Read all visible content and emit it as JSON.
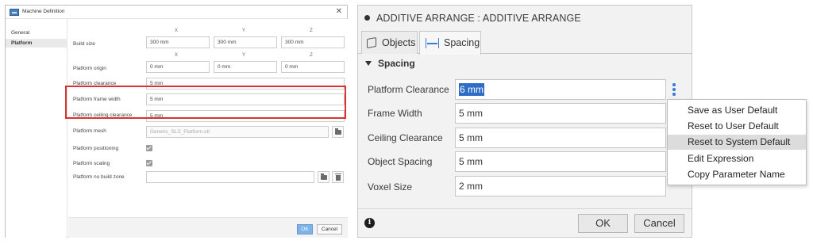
{
  "machine_definition": {
    "title": "Machine Definition",
    "close_glyph": "✕",
    "nav": [
      "General",
      "Platform"
    ],
    "axes": [
      "X",
      "Y",
      "Z"
    ],
    "build_size": {
      "label": "Build size",
      "x": "300 mm",
      "y": "300 mm",
      "z": "300 mm"
    },
    "platform_origin": {
      "label": "Platform origin",
      "x": "0 mm",
      "y": "0 mm",
      "z": "0 mm"
    },
    "platform_clearance": {
      "label": "Platform clearance",
      "value": "5 mm"
    },
    "platform_frame_width": {
      "label": "Platform frame width",
      "value": "5 mm"
    },
    "platform_ceiling_clearance": {
      "label": "Platform ceiling clearance",
      "value": "5 mm"
    },
    "platform_mesh": {
      "label": "Platform mesh",
      "value": "Generic_SLS_Platform.stl"
    },
    "platform_positioning": {
      "label": "Platform positioning",
      "checked": true
    },
    "platform_scaling": {
      "label": "Platform scaling",
      "checked": true
    },
    "platform_no_build_zone": {
      "label": "Platform no build zone",
      "value": ""
    },
    "ok_label": "OK",
    "cancel_label": "Cancel",
    "highlight_color": "#d8332c"
  },
  "additive_arrange": {
    "title": "ADDITIVE ARRANGE : ADDITIVE ARRANGE",
    "tabs": {
      "objects": "Objects",
      "spacing": "Spacing",
      "active": "spacing"
    },
    "section": "Spacing",
    "fields": [
      {
        "label": "Platform Clearance",
        "value": "6 mm",
        "selected": true
      },
      {
        "label": "Frame Width",
        "value": "5 mm"
      },
      {
        "label": "Ceiling Clearance",
        "value": "5 mm"
      },
      {
        "label": "Object Spacing",
        "value": "5 mm"
      },
      {
        "label": "Voxel Size",
        "value": "2 mm"
      }
    ],
    "info_glyph": "i",
    "ok_label": "OK",
    "cancel_label": "Cancel",
    "accent_color": "#3b7bd8",
    "selection_color": "#2d6cc7"
  },
  "context_menu": {
    "items": [
      "Save as User Default",
      "Reset to User Default",
      "Reset to System Default",
      "Edit Expression",
      "Copy Parameter Name"
    ],
    "highlighted": "Reset to System Default"
  }
}
